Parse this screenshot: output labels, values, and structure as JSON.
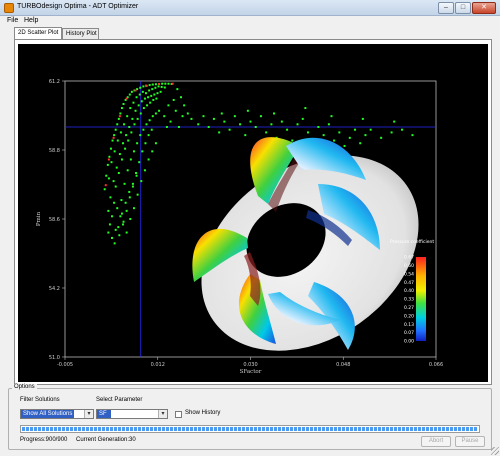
{
  "window": {
    "title": "TURBOdesign Optima - ADT Optimizer",
    "minimize_glyph": "–",
    "maximize_glyph": "□",
    "close_glyph": "✕"
  },
  "menu": [
    "File",
    "Help"
  ],
  "tabs": [
    {
      "label": "2D Scatter Plot",
      "active": true
    },
    {
      "label": "History Plot",
      "active": false
    }
  ],
  "chart_data": {
    "type": "scatter",
    "title": "",
    "xlabel": "SFactor",
    "ylabel": "Pmin",
    "xlim": [
      -0.005,
      0.066
    ],
    "ylim": [
      51.0,
      61.2
    ],
    "xticks": [
      "-0.005",
      "0.012",
      "0.030",
      "0.048",
      "0.066"
    ],
    "yticks": [
      "51.0",
      "54.2",
      "58.6",
      "58.8",
      "61.2"
    ],
    "crosshair": {
      "x": 0.0095,
      "y": 59.5
    },
    "series": [
      {
        "color": "#22ff22",
        "points": [
          [
            0.0026,
            57.2
          ],
          [
            0.0029,
            57.7
          ],
          [
            0.0032,
            58.1
          ],
          [
            0.0035,
            58.4
          ],
          [
            0.0038,
            58.7
          ],
          [
            0.0041,
            59.0
          ],
          [
            0.0044,
            59.2
          ],
          [
            0.0047,
            59.4
          ],
          [
            0.005,
            59.6
          ],
          [
            0.0053,
            59.8
          ],
          [
            0.0056,
            60.0
          ],
          [
            0.0059,
            60.2
          ],
          [
            0.0062,
            60.35
          ],
          [
            0.0066,
            60.5
          ],
          [
            0.007,
            60.6
          ],
          [
            0.0074,
            60.7
          ],
          [
            0.0078,
            60.8
          ],
          [
            0.0083,
            60.85
          ],
          [
            0.0088,
            60.9
          ],
          [
            0.0094,
            60.95
          ],
          [
            0.01,
            61.0
          ],
          [
            0.0106,
            61.02
          ],
          [
            0.0112,
            61.05
          ],
          [
            0.0118,
            61.07
          ],
          [
            0.0124,
            61.08
          ],
          [
            0.013,
            61.09
          ],
          [
            0.0136,
            61.1
          ],
          [
            0.0142,
            61.1
          ],
          [
            0.0148,
            61.1
          ],
          [
            0.0154,
            61.09
          ],
          [
            0.0034,
            57.6
          ],
          [
            0.0039,
            58.2
          ],
          [
            0.0045,
            58.6
          ],
          [
            0.0051,
            59.0
          ],
          [
            0.0057,
            59.3
          ],
          [
            0.0063,
            59.6
          ],
          [
            0.0069,
            59.9
          ],
          [
            0.0075,
            60.2
          ],
          [
            0.0081,
            60.4
          ],
          [
            0.0087,
            60.6
          ],
          [
            0.0093,
            60.7
          ],
          [
            0.0099,
            60.8
          ],
          [
            0.0105,
            60.75
          ],
          [
            0.0111,
            60.85
          ],
          [
            0.0117,
            60.9
          ],
          [
            0.0123,
            60.95
          ],
          [
            0.0129,
            61.0
          ],
          [
            0.0135,
            60.98
          ],
          [
            0.0141,
            60.96
          ],
          [
            0.0037,
            56.9
          ],
          [
            0.0043,
            57.5
          ],
          [
            0.0049,
            58.0
          ],
          [
            0.0055,
            58.5
          ],
          [
            0.0061,
            58.9
          ],
          [
            0.0067,
            59.2
          ],
          [
            0.0073,
            59.5
          ],
          [
            0.0079,
            59.8
          ],
          [
            0.0085,
            60.1
          ],
          [
            0.0091,
            60.3
          ],
          [
            0.0097,
            60.45
          ],
          [
            0.0103,
            60.55
          ],
          [
            0.0109,
            60.6
          ],
          [
            0.0115,
            60.65
          ],
          [
            0.0121,
            60.7
          ],
          [
            0.0127,
            60.75
          ],
          [
            0.0133,
            60.8
          ],
          [
            0.0047,
            57.3
          ],
          [
            0.0053,
            57.8
          ],
          [
            0.0059,
            58.3
          ],
          [
            0.0065,
            58.7
          ],
          [
            0.0071,
            59.0
          ],
          [
            0.0077,
            59.3
          ],
          [
            0.0083,
            59.6
          ],
          [
            0.0089,
            59.8
          ],
          [
            0.0095,
            60.0
          ],
          [
            0.0101,
            60.2
          ],
          [
            0.0107,
            60.3
          ],
          [
            0.0113,
            60.4
          ],
          [
            0.0119,
            60.5
          ],
          [
            0.0125,
            60.55
          ],
          [
            0.0058,
            56.8
          ],
          [
            0.0064,
            57.4
          ],
          [
            0.007,
            57.9
          ],
          [
            0.0076,
            58.3
          ],
          [
            0.0082,
            58.6
          ],
          [
            0.0088,
            58.9
          ],
          [
            0.0094,
            59.2
          ],
          [
            0.01,
            59.4
          ],
          [
            0.0106,
            59.6
          ],
          [
            0.0112,
            59.75
          ],
          [
            0.0118,
            59.9
          ],
          [
            0.0124,
            60.0
          ],
          [
            0.013,
            60.1
          ],
          [
            0.0033,
            56.4
          ],
          [
            0.0036,
            55.9
          ],
          [
            0.004,
            56.2
          ],
          [
            0.0044,
            56.7
          ],
          [
            0.005,
            56.5
          ],
          [
            0.0056,
            56.2
          ],
          [
            0.0062,
            56.0
          ],
          [
            0.0068,
            56.4
          ],
          [
            0.0074,
            56.9
          ],
          [
            0.008,
            57.3
          ],
          [
            0.0086,
            57.8
          ],
          [
            0.0092,
            58.2
          ],
          [
            0.0098,
            58.6
          ],
          [
            0.0104,
            58.9
          ],
          [
            0.011,
            59.2
          ],
          [
            0.0116,
            59.4
          ],
          [
            0.0033,
            55.6
          ],
          [
            0.004,
            55.4
          ],
          [
            0.0047,
            55.7
          ],
          [
            0.0054,
            55.5
          ],
          [
            0.0061,
            55.9
          ],
          [
            0.0068,
            55.6
          ],
          [
            0.0075,
            56.1
          ],
          [
            0.0082,
            56.5
          ],
          [
            0.0089,
            57.0
          ],
          [
            0.0096,
            57.5
          ],
          [
            0.0103,
            57.9
          ],
          [
            0.011,
            58.3
          ],
          [
            0.0117,
            58.6
          ],
          [
            0.0124,
            58.9
          ],
          [
            0.0045,
            55.2
          ],
          [
            0.0052,
            55.8
          ],
          [
            0.0059,
            56.3
          ],
          [
            0.0066,
            56.7
          ],
          [
            0.0073,
            57.1
          ],
          [
            0.008,
            57.4
          ],
          [
            0.0087,
            57.7
          ],
          [
            0.0165,
            60.9
          ],
          [
            0.0172,
            60.6
          ],
          [
            0.0178,
            60.3
          ],
          [
            0.0185,
            60.0
          ],
          [
            0.0192,
            59.8
          ],
          [
            0.0158,
            60.5
          ],
          [
            0.0162,
            60.1
          ],
          [
            0.0148,
            60.3
          ],
          [
            0.0152,
            59.7
          ],
          [
            0.0168,
            59.5
          ],
          [
            0.0175,
            59.9
          ],
          [
            0.014,
            59.9
          ],
          [
            0.0145,
            59.5
          ],
          [
            0.0205,
            59.6
          ],
          [
            0.0215,
            59.9
          ],
          [
            0.0225,
            59.5
          ],
          [
            0.0235,
            59.8
          ],
          [
            0.0245,
            59.3
          ],
          [
            0.0255,
            59.7
          ],
          [
            0.0265,
            59.4
          ],
          [
            0.0275,
            59.9
          ],
          [
            0.0285,
            59.6
          ],
          [
            0.0295,
            59.2
          ],
          [
            0.0305,
            59.7
          ],
          [
            0.0315,
            59.5
          ],
          [
            0.0325,
            59.9
          ],
          [
            0.0335,
            59.3
          ],
          [
            0.0345,
            59.6
          ],
          [
            0.0355,
            59.1
          ],
          [
            0.0365,
            59.7
          ],
          [
            0.0375,
            59.4
          ],
          [
            0.0385,
            59.0
          ],
          [
            0.0395,
            59.6
          ],
          [
            0.0405,
            59.8
          ],
          [
            0.0415,
            59.3
          ],
          [
            0.0425,
            58.9
          ],
          [
            0.0435,
            59.5
          ],
          [
            0.0445,
            59.2
          ],
          [
            0.0455,
            59.6
          ],
          [
            0.0465,
            59.0
          ],
          [
            0.0475,
            59.3
          ],
          [
            0.0485,
            58.8
          ],
          [
            0.0495,
            59.1
          ],
          [
            0.0505,
            59.4
          ],
          [
            0.0515,
            58.9
          ],
          [
            0.0525,
            59.2
          ],
          [
            0.0535,
            59.4
          ],
          [
            0.0555,
            59.1
          ],
          [
            0.0575,
            59.3
          ],
          [
            0.0595,
            59.4
          ],
          [
            0.0615,
            59.2
          ],
          [
            0.025,
            60.0
          ],
          [
            0.03,
            60.1
          ],
          [
            0.035,
            60.0
          ],
          [
            0.041,
            60.2
          ],
          [
            0.046,
            59.9
          ],
          [
            0.052,
            59.8
          ],
          [
            0.058,
            59.7
          ]
        ]
      },
      {
        "color": "#ff3030",
        "points": [
          [
            0.0028,
            57.35
          ],
          [
            0.0034,
            58.3
          ],
          [
            0.0043,
            59.1
          ],
          [
            0.0055,
            59.9
          ],
          [
            0.0068,
            60.55
          ],
          [
            0.0085,
            60.85
          ],
          [
            0.0105,
            61.03
          ],
          [
            0.013,
            61.09
          ],
          [
            0.0156,
            61.1
          ]
        ]
      }
    ]
  },
  "colorbar": {
    "title": "Pressure coefficient",
    "ticks": [
      "0.67",
      "0.60",
      "0.54",
      "0.47",
      "0.40",
      "0.33",
      "0.27",
      "0.20",
      "0.13",
      "0.07",
      "0.00"
    ]
  },
  "options": {
    "legend": "Options",
    "filter_label": "Filter Solutions",
    "filter_value": "Show All Solutions",
    "parameter_label": "Select Parameter",
    "parameter_value": "SF",
    "show_history_label": "Show History",
    "show_history_checked": false,
    "progress": 1.0,
    "progress_text": "Progress:900/900",
    "generation_text": "Current Generation:30",
    "abort_label": "Abort",
    "pause_label": "Pause",
    "dropdown_arrow": "▾"
  }
}
